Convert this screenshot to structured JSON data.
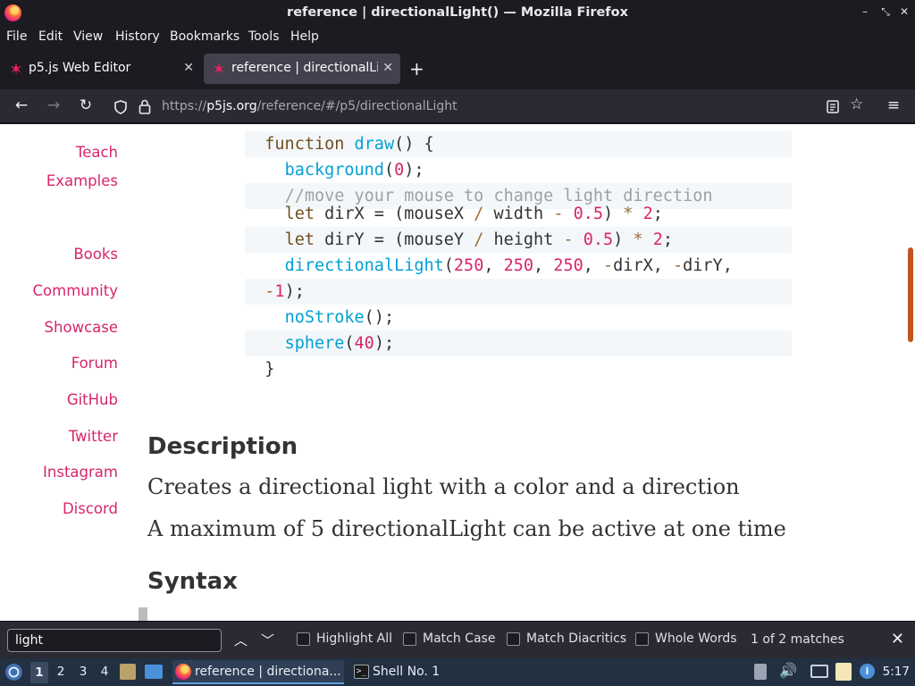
{
  "window": {
    "title": "reference | directionalLight() — Mozilla Firefox"
  },
  "menu": [
    "File",
    "Edit",
    "View",
    "History",
    "Bookmarks",
    "Tools",
    "Help"
  ],
  "tabs": [
    {
      "label": "p5.js Web Editor",
      "active": false
    },
    {
      "label": "reference | directionalLig",
      "active": true
    }
  ],
  "navbar": {
    "url_prefix": "https://",
    "url_host": "p5js.org",
    "url_path": "/reference/#/p5/directionalLight"
  },
  "sidenav": [
    "Teach",
    "Examples",
    "Books",
    "Community",
    "Showcase",
    "Forum",
    "GitHub",
    "Twitter",
    "Instagram",
    "Discord"
  ],
  "code_lines": [
    "function draw() {",
    "  background(0);",
    "  //move your mouse to change light direction",
    "  let dirX = (mouseX / width - 0.5) * 2;",
    "  let dirY = (mouseY / height - 0.5) * 2;",
    "  directionalLight(250, 250, 250, -dirX, -dirY,",
    "-1);",
    "  noStroke();",
    "  sphere(40);",
    "}"
  ],
  "description": {
    "heading": "Description",
    "p1": "Creates a directional light with a color and a direction",
    "p2": "A maximum of 5 directionalLight can be active at one time"
  },
  "syntax_heading": "Syntax",
  "findbar": {
    "query": "light",
    "options": [
      "Highlight All",
      "Match Case",
      "Match Diacritics",
      "Whole Words"
    ],
    "match_count": "1 of 2 matches"
  },
  "taskbar": {
    "workspaces": [
      "1",
      "2",
      "3",
      "4"
    ],
    "tasks": [
      "reference | directiona...",
      "Shell No. 1"
    ],
    "clock": "5:17"
  },
  "colors": {
    "accent": "#d7256b",
    "scrollbar": "#c2541f",
    "chrome": "#2b2a33"
  }
}
